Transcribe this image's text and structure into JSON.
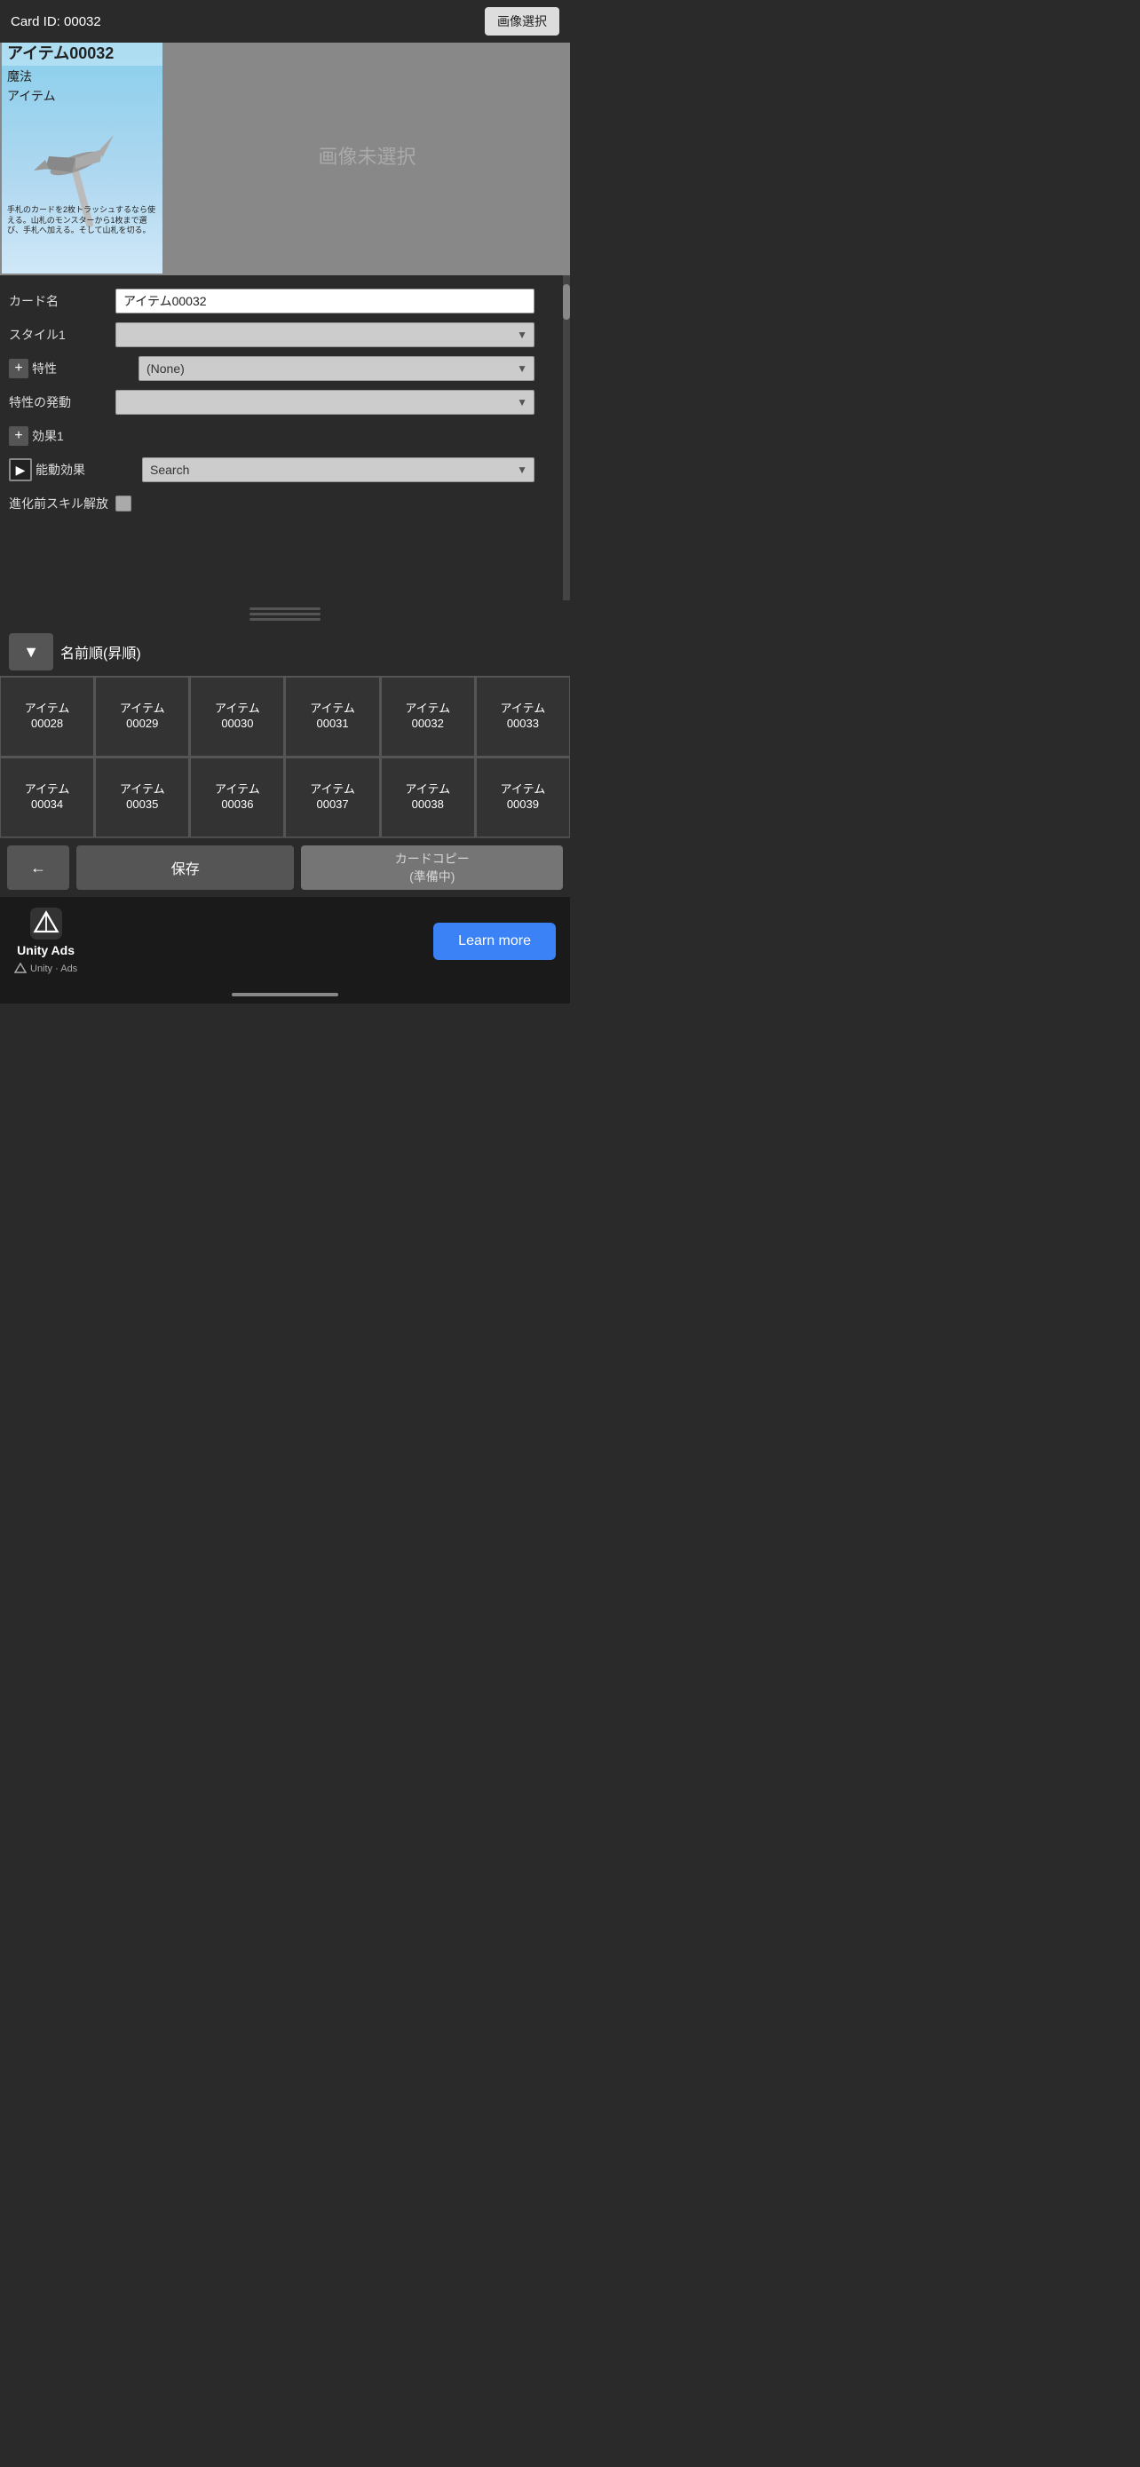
{
  "cardId": {
    "label": "Card ID: 00032",
    "imageSelectBtn": "画像選択"
  },
  "cardPreview": {
    "title": "アイテム00032",
    "type1": "魔法",
    "type2": "アイテム",
    "description": "手札のカードを2枚トラッシュするなら使える。山札のモンスターから1枚まで選び、手札へ加える。そして山札を切る。",
    "noImage": "画像未選択"
  },
  "form": {
    "fields": [
      {
        "label": "カード名",
        "type": "input",
        "value": "アイテム00032",
        "placeholder": ""
      },
      {
        "label": "スタイル1",
        "type": "select",
        "value": "",
        "prefix": ""
      },
      {
        "label": "特性",
        "type": "select",
        "value": "(None)",
        "prefix": "plus"
      },
      {
        "label": "特性の発動",
        "type": "select",
        "value": "",
        "prefix": ""
      },
      {
        "label": "効果1",
        "type": "label",
        "value": "",
        "prefix": "plus"
      },
      {
        "label": "能動効果",
        "type": "select",
        "value": "Search",
        "prefix": "play"
      },
      {
        "label": "進化前スキル解放",
        "type": "checkbox",
        "value": ""
      }
    ]
  },
  "sortBar": {
    "dropdownLabel": "▼",
    "sortLabel": "名前順(昇順)"
  },
  "gridCards": [
    "アイテム\n00028",
    "アイテム\n00029",
    "アイテム\n00030",
    "アイテム\n00031",
    "アイテム\n00032",
    "アイテム\n00033",
    "アイテム\n00034",
    "アイテム\n00035",
    "アイテム\n00036",
    "アイテム\n00037",
    "アイテム\n00038",
    "アイテム\n00039"
  ],
  "bottomButtons": {
    "back": "←",
    "save": "保存",
    "copy": "カードコピー\n(準備中)"
  },
  "adBanner": {
    "brand": "Unity Ads",
    "smallText": "Unity · Ads",
    "learnMore": "Learn more"
  }
}
